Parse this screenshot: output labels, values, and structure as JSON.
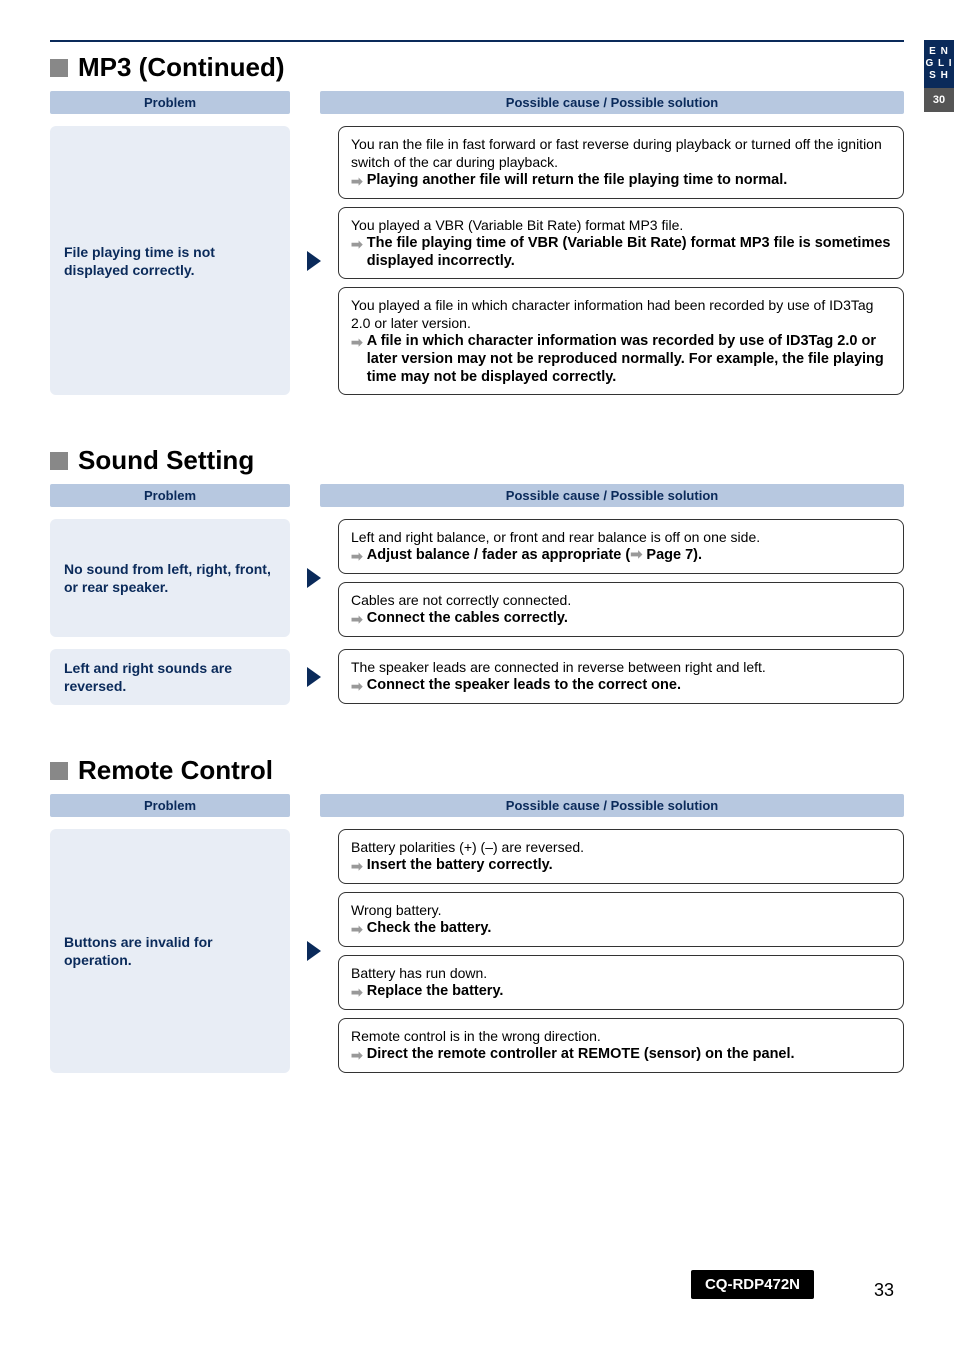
{
  "sideTab": {
    "lang": "E\nN\nG\nL\nI\nS\nH",
    "num": "30"
  },
  "labels": {
    "problem": "Problem",
    "solution": "Possible cause / Possible solution"
  },
  "sections": [
    {
      "title": "MP3 (Continued)",
      "rows": [
        {
          "problem": "File playing time is not displayed correctly.",
          "solutions": [
            {
              "cause": "You ran the file in fast forward or fast reverse during playback or turned off the ignition switch of the car during playback.",
              "action": "Playing another file will return the file playing time to normal."
            },
            {
              "cause": "You played a VBR (Variable Bit Rate) format MP3 file.",
              "action": "The file playing time of VBR (Variable Bit Rate) format MP3 file is sometimes displayed incorrectly."
            },
            {
              "cause": "You played a file in which character information had been recorded by use of ID3Tag 2.0 or later version.",
              "action": "A file in which character information was recorded by use of ID3Tag 2.0 or later version may not be reproduced normally. For example, the file playing time may not be displayed correctly."
            }
          ]
        }
      ]
    },
    {
      "title": "Sound Setting",
      "rows": [
        {
          "problem": "No sound from left, right, front, or rear speaker.",
          "solutions": [
            {
              "cause": "Left and right balance, or front and rear balance is off on one side.",
              "actionPrefix": "Adjust balance / fader as appropriate (",
              "actionRef": " Page 7).",
              "hasPageRef": true
            },
            {
              "cause": "Cables are not correctly connected.",
              "action": "Connect the cables correctly."
            }
          ]
        },
        {
          "problem": "Left and right sounds are reversed.",
          "solutions": [
            {
              "cause": "The speaker leads are connected in reverse between right and left.",
              "action": "Connect the speaker leads to the correct one."
            }
          ]
        }
      ]
    },
    {
      "title": "Remote Control",
      "rows": [
        {
          "problem": "Buttons are invalid for operation.",
          "solutions": [
            {
              "cause": "Battery polarities (+) (–) are reversed.",
              "action": "Insert the battery correctly."
            },
            {
              "cause": "Wrong battery.",
              "action": "Check the battery."
            },
            {
              "cause": "Battery has run down.",
              "action": "Replace the battery."
            },
            {
              "cause": "Remote control is in the wrong direction.",
              "action": "Direct the remote controller at REMOTE (sensor) on the panel."
            }
          ]
        }
      ]
    }
  ],
  "footer": {
    "model": "CQ-RDP472N",
    "page": "33"
  }
}
